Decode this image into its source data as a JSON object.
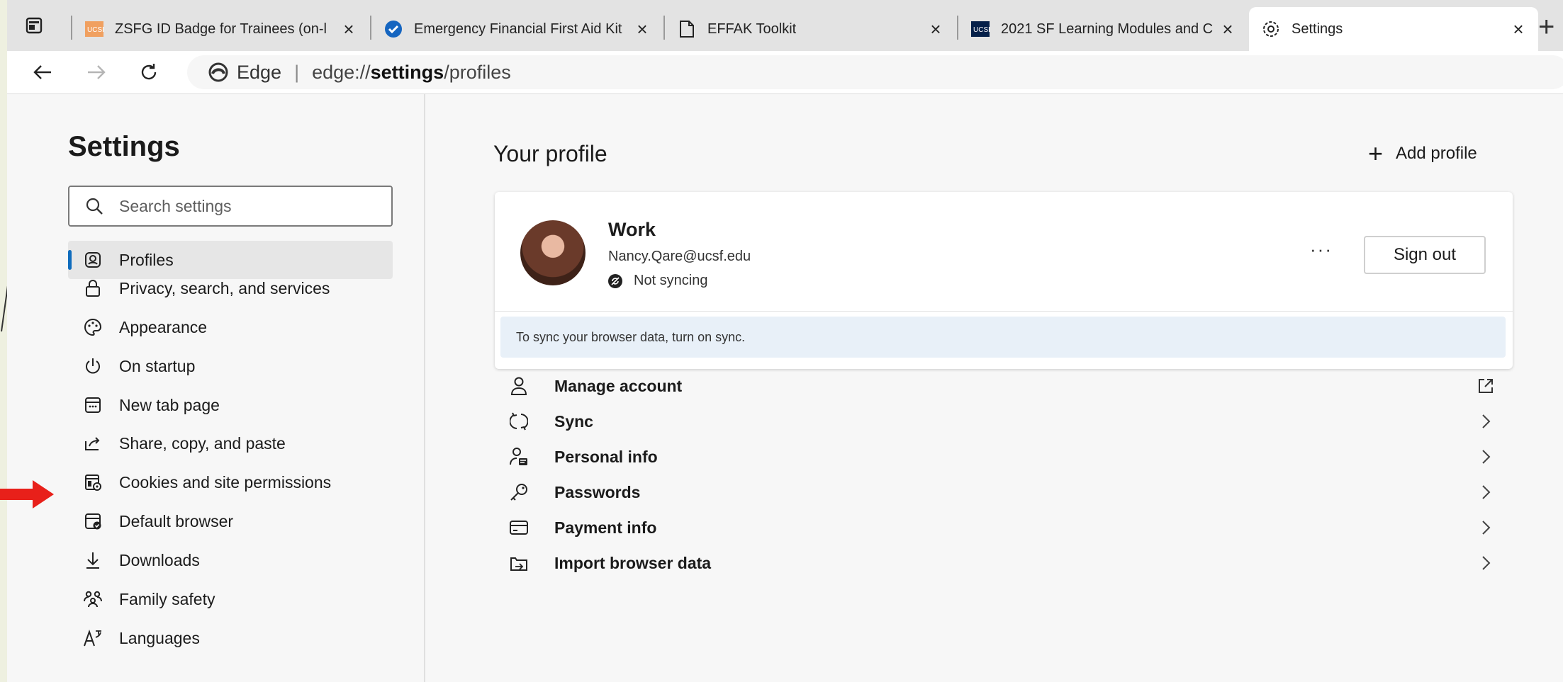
{
  "tabs": [
    {
      "title": "ZSFG ID Badge for Trainees (on-l",
      "favicon": "ucsf-logo-icon",
      "active": false
    },
    {
      "title": "Emergency Financial First Aid Kit",
      "favicon": "check-circle-icon",
      "active": false
    },
    {
      "title": "EFFAK Toolkit",
      "favicon": "document-icon",
      "active": false
    },
    {
      "title": "2021 SF Learning Modules and C",
      "favicon": "ucsf-logo-icon",
      "active": false
    },
    {
      "title": "Settings",
      "favicon": "gear-icon",
      "active": true
    }
  ],
  "address": {
    "brand": "Edge",
    "url_prefix": "edge://",
    "url_strong": "settings",
    "url_suffix": "/profiles"
  },
  "nav": {
    "title": "Settings",
    "search_placeholder": "Search settings",
    "items": [
      {
        "label": "Profiles",
        "icon": "profile-icon",
        "selected": true
      },
      {
        "label": "Privacy, search, and services",
        "icon": "lock-icon"
      },
      {
        "label": "Appearance",
        "icon": "palette-icon"
      },
      {
        "label": "On startup",
        "icon": "power-icon"
      },
      {
        "label": "New tab page",
        "icon": "new-tab-icon"
      },
      {
        "label": "Share, copy, and paste",
        "icon": "share-icon"
      },
      {
        "label": "Cookies and site permissions",
        "icon": "cookie-permissions-icon"
      },
      {
        "label": "Default browser",
        "icon": "default-browser-icon"
      },
      {
        "label": "Downloads",
        "icon": "download-icon"
      },
      {
        "label": "Family safety",
        "icon": "family-icon"
      },
      {
        "label": "Languages",
        "icon": "languages-icon"
      }
    ]
  },
  "main": {
    "title": "Your profile",
    "add_profile": "Add profile",
    "profile": {
      "name": "Work",
      "email": "Nancy.Qare@ucsf.edu",
      "sync_status": "Not syncing",
      "more": "···",
      "sign_out": "Sign out",
      "banner": "To sync your browser data, turn on sync."
    },
    "rows": [
      {
        "label": "Manage account",
        "icon": "person-icon",
        "trailing": "external-link-icon"
      },
      {
        "label": "Sync",
        "icon": "sync-icon",
        "trailing": "chevron-right-icon"
      },
      {
        "label": "Personal info",
        "icon": "personal-info-icon",
        "trailing": "chevron-right-icon"
      },
      {
        "label": "Passwords",
        "icon": "key-icon",
        "trailing": "chevron-right-icon"
      },
      {
        "label": "Payment info",
        "icon": "card-icon",
        "trailing": "chevron-right-icon"
      },
      {
        "label": "Import browser data",
        "icon": "import-icon",
        "trailing": "chevron-right-icon"
      }
    ]
  },
  "colors": {
    "accent": "#0f6cbd",
    "annotation_arrow": "#e8201a",
    "sync_banner": "#e8f0f8"
  }
}
